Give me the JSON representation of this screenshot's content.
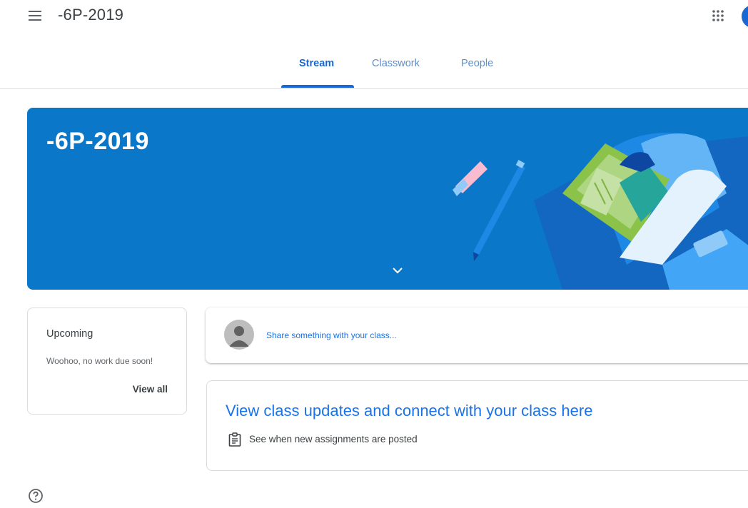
{
  "header": {
    "title": "-6P-2019"
  },
  "tabs": [
    {
      "label": "Stream",
      "active": true
    },
    {
      "label": "Classwork",
      "active": false
    },
    {
      "label": "People",
      "active": false
    }
  ],
  "banner": {
    "title": "-6P-2019",
    "color": "#0b77c8"
  },
  "upcoming": {
    "title": "Upcoming",
    "note": "Woohoo, no work due soon!",
    "link": "View all"
  },
  "share": {
    "placeholder": "Share something with your class..."
  },
  "updates": {
    "title": "View class updates and connect with your class here",
    "note": "See when new assignments are posted"
  },
  "colors": {
    "accent": "#1967d2",
    "link": "#1a73e8"
  }
}
